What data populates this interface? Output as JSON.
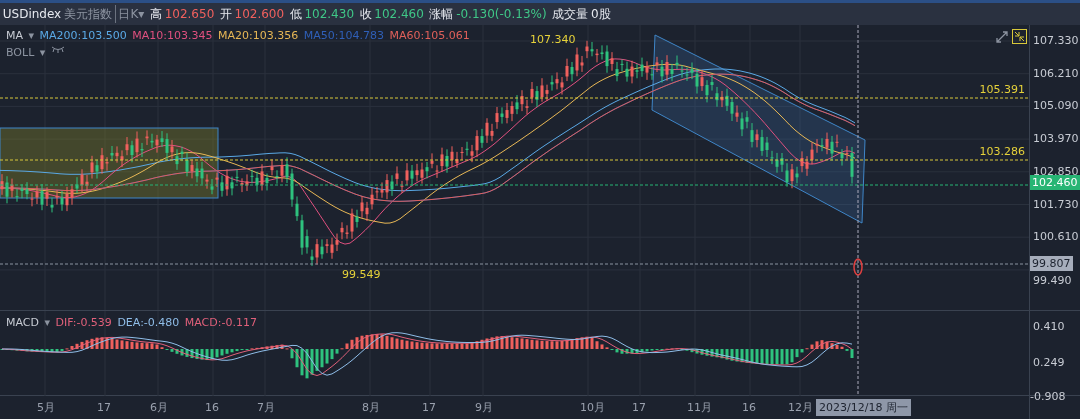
{
  "header": {
    "symbol": "USDindex",
    "name": "美元指数",
    "period": "日K",
    "caret": "▾",
    "quotes": [
      {
        "label": "高",
        "value": "102.650",
        "color": "#f0605d"
      },
      {
        "label": "开",
        "value": "102.600",
        "color": "#f0605d"
      },
      {
        "label": "低",
        "value": "102.430",
        "color": "#3fc787"
      },
      {
        "label": "收",
        "value": "102.460",
        "color": "#3fc787"
      },
      {
        "label": "涨幅",
        "value": "-0.130(-0.13%)",
        "color": "#3fc787"
      },
      {
        "label": "成交量",
        "value": "0股",
        "color": "#e6e9ef"
      }
    ]
  },
  "main_chart": {
    "indicator": "MA",
    "caret": "▾",
    "averages": [
      {
        "text": "MA200:103.500",
        "color": "#5aa9e6"
      },
      {
        "text": "MA10:103.345",
        "color": "#e0507f"
      },
      {
        "text": "MA20:103.356",
        "color": "#e7b755"
      },
      {
        "text": "MA50:104.783",
        "color": "#2f5fb8"
      },
      {
        "text": "MA60:105.061",
        "color": "#e0605a"
      }
    ],
    "overlay": "BOLL",
    "high_label": "107.340",
    "low_label": "99.549",
    "level_lines": [
      "105.391",
      "103.286"
    ],
    "price_axis": [
      "107.330",
      "106.210",
      "105.090",
      "103.970",
      "102.850",
      "101.730",
      "100.610",
      "99.490"
    ],
    "current_price": "102.460",
    "cursor_price": "99.807"
  },
  "macd": {
    "indicator": "MACD",
    "caret": "▾",
    "values": [
      {
        "text": "DIF:-0.539",
        "color": "#e0607a"
      },
      {
        "text": "DEA:-0.480",
        "color": "#8fbde8"
      },
      {
        "text": "MACD:-0.117",
        "color": "#e0607a"
      }
    ],
    "axis": [
      "0.410",
      "0.249",
      "-0.908"
    ]
  },
  "time_axis": {
    "labels": [
      "5月",
      "17",
      "6月",
      "16",
      "7月",
      "8月",
      "17",
      "9月",
      "10月",
      "17",
      "11月",
      "16",
      "12月"
    ],
    "cursor_date": "2023/12/18 周一"
  }
}
